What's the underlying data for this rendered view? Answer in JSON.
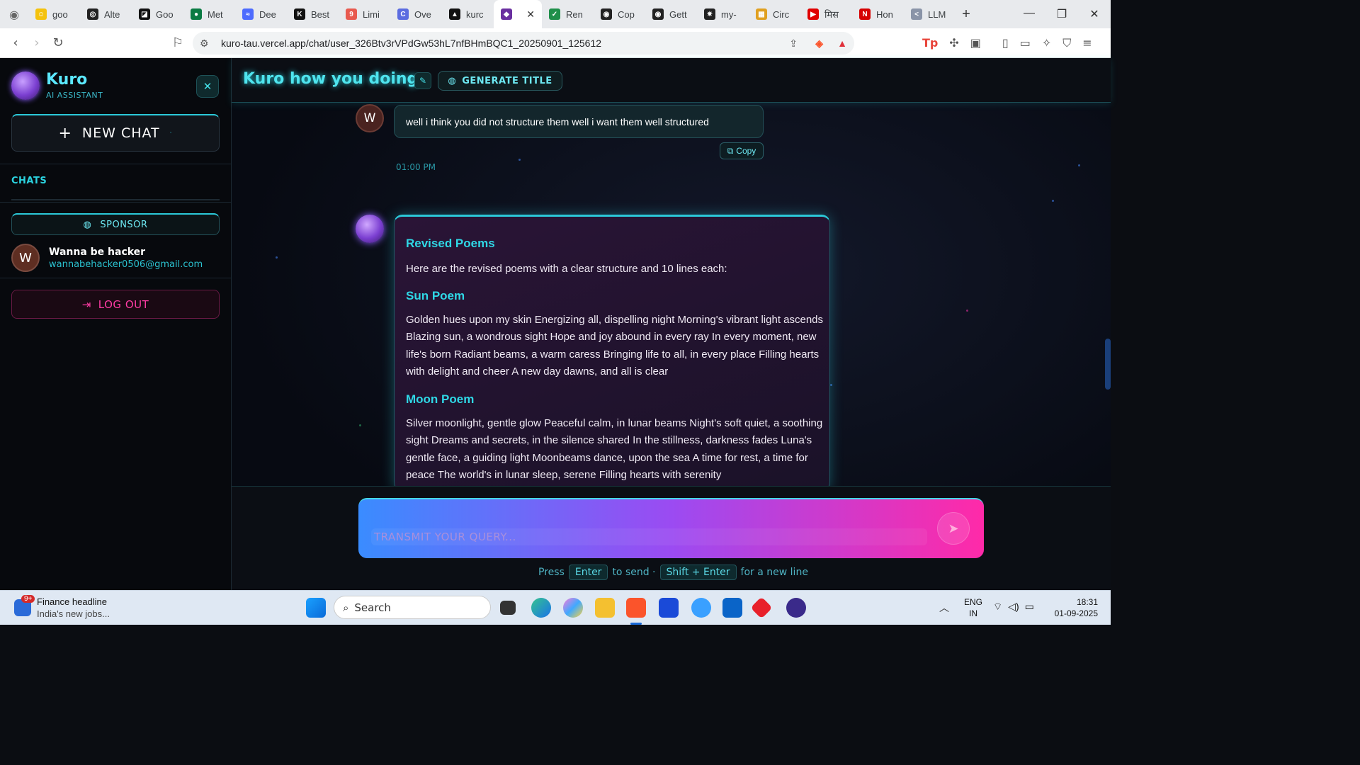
{
  "browser": {
    "tabs": [
      {
        "label": "goo",
        "color": "#f4c20d",
        "glyph": "☺"
      },
      {
        "label": "Alte",
        "color": "#222222",
        "glyph": "◎"
      },
      {
        "label": "Goo",
        "color": "#111111",
        "glyph": "◪"
      },
      {
        "label": "Met",
        "color": "#0a7b43",
        "glyph": "●"
      },
      {
        "label": "Dee",
        "color": "#4d6bfe",
        "glyph": "≈"
      },
      {
        "label": "Best",
        "color": "#111111",
        "glyph": "K"
      },
      {
        "label": "Limi",
        "color": "#e85a4f",
        "glyph": "9"
      },
      {
        "label": "Ove",
        "color": "#5b6ce0",
        "glyph": "C"
      },
      {
        "label": "kurc",
        "color": "#111111",
        "glyph": "▲"
      },
      {
        "label": "",
        "color": "#6a2fa0",
        "glyph": "◆",
        "active": true
      },
      {
        "label": "Ren",
        "color": "#1f8f4a",
        "glyph": "✓"
      },
      {
        "label": "Cop",
        "color": "#222222",
        "glyph": "◉"
      },
      {
        "label": "Gett",
        "color": "#222222",
        "glyph": "◉"
      },
      {
        "label": "my-",
        "color": "#222222",
        "glyph": "✷"
      },
      {
        "label": "Circ",
        "color": "#e0a020",
        "glyph": "▦"
      },
      {
        "label": "मिस",
        "color": "#e00000",
        "glyph": "▶"
      },
      {
        "label": "Hon",
        "color": "#d60000",
        "glyph": "N"
      },
      {
        "label": "LLM",
        "color": "#8a94a8",
        "glyph": "<"
      }
    ],
    "url": "kuro-tau.vercel.app/chat/user_326Btv3rVPdGw53hL7nfBHmBQC1_20250901_125612"
  },
  "sidebar": {
    "brand": "Kuro",
    "brand_sub": "AI ASSISTANT",
    "new_chat": "NEW CHAT",
    "chats_label": "CHATS",
    "sponsor": "SPONSOR",
    "user": {
      "initial": "W",
      "name": "Wanna be hacker",
      "email": "wannabehacker0506@gmail.com"
    },
    "logout": "LOG OUT"
  },
  "chat": {
    "title": "Kuro how you doing",
    "generate_title": "GENERATE TITLE",
    "user_message": {
      "initial": "W",
      "text": "well i think you did not structure them well i want them well structured",
      "copy": "Copy",
      "time": "01:00 PM"
    },
    "bot_message": {
      "heading": "Revised Poems",
      "intro": "Here are the revised poems with a clear structure and 10 lines each:",
      "sun_heading": "Sun Poem",
      "sun_text": "Golden hues upon my skin Energizing all, dispelling night Morning's vibrant light ascends Blazing sun, a wondrous sight Hope and joy abound in every ray In every moment, new life's born Radiant beams, a warm caress Bringing life to all, in every place Filling hearts with delight and cheer A new day dawns, and all is clear",
      "moon_heading": "Moon Poem",
      "moon_text": "Silver moonlight, gentle glow Peaceful calm, in lunar beams Night's soft quiet, a soothing sight Dreams and secrets, in the silence shared In the stillness, darkness fades Luna's gentle face, a guiding light Moonbeams dance, upon the sea A time for rest, a time for peace The world's in lunar sleep, serene Filling hearts with serenity"
    },
    "input_placeholder": "TRANSMIT YOUR QUERY...",
    "hint": {
      "press": "Press",
      "enter": "Enter",
      "to_send": "to send ·",
      "shift_enter": "Shift + Enter",
      "new_line": "for a new line"
    }
  },
  "taskbar": {
    "news_title": "Finance headline",
    "news_sub": "India's new jobs...",
    "news_badge": "9+",
    "search": "Search",
    "lang": "ENG",
    "region": "IN",
    "time": "18:31",
    "date": "01-09-2025"
  }
}
